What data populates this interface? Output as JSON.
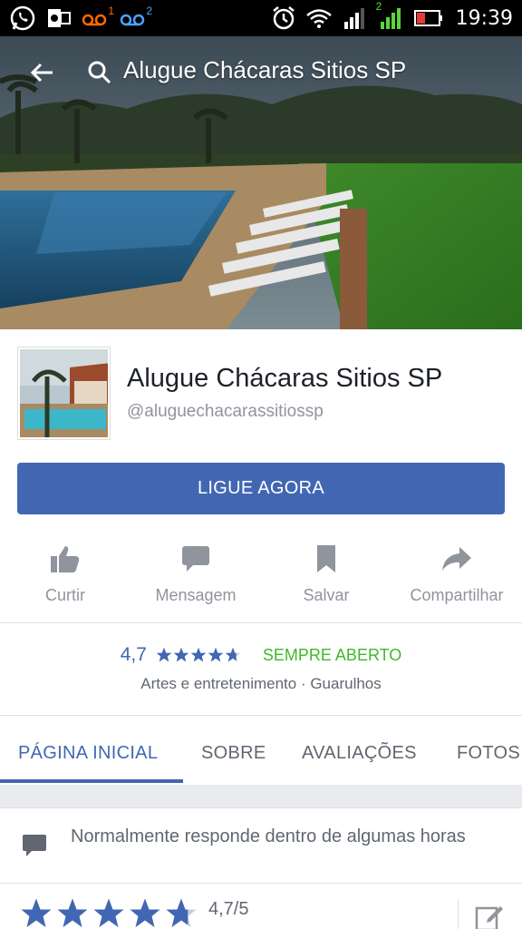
{
  "status_bar": {
    "time": "19:39",
    "notif_badge_1": "1",
    "notif_badge_2": "2",
    "network_badge": "2"
  },
  "search": {
    "query": "Alugue Chácaras Sitios SP"
  },
  "profile": {
    "name": "Alugue Chácaras Sitios SP",
    "handle": "@aluguechacarassitiossp"
  },
  "cta": {
    "label": "LIGUE AGORA"
  },
  "actions": [
    {
      "label": "Curtir",
      "icon": "thumbs-up-icon"
    },
    {
      "label": "Mensagem",
      "icon": "message-icon"
    },
    {
      "label": "Salvar",
      "icon": "bookmark-icon"
    },
    {
      "label": "Compartilhar",
      "icon": "share-icon"
    }
  ],
  "rating": {
    "value": "4,7",
    "stars": 4.7,
    "open_status": "SEMPRE ABERTO",
    "category_location": "Artes e entretenimento · Guarulhos"
  },
  "tabs": [
    {
      "label": "PÁGINA INICIAL",
      "active": true
    },
    {
      "label": "SOBRE",
      "active": false
    },
    {
      "label": "AVALIAÇÕES",
      "active": false
    },
    {
      "label": "FOTOS",
      "active": false
    }
  ],
  "card": {
    "response_text": "Normalmente responde dentro de algumas horas",
    "rating_text": "4,7/5",
    "stars": 4.7
  },
  "colors": {
    "brand_blue": "#4267b2",
    "open_green": "#42b72a",
    "muted_text": "#90949c"
  }
}
